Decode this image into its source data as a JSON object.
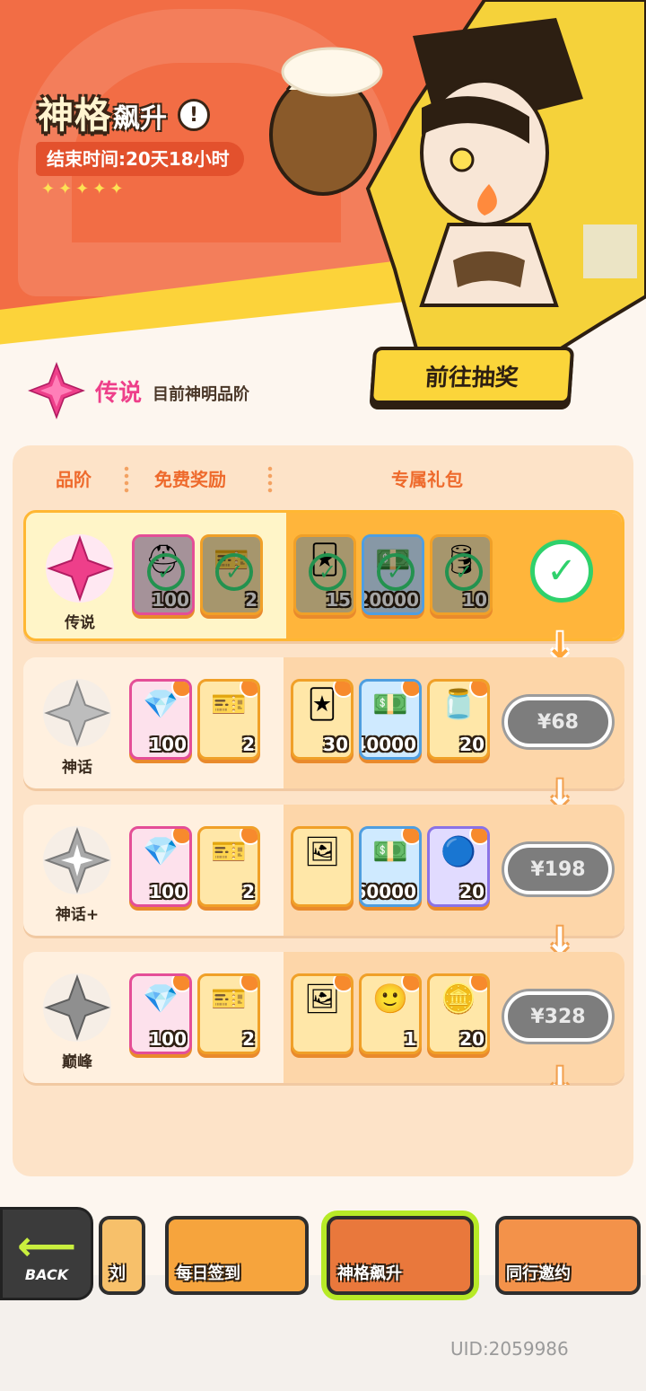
{
  "header": {
    "title_main": "神格",
    "title_sub": "飙升",
    "info_icon": "!",
    "end_time": "结束时间:20天18小时",
    "stars": "✦✦✦✦✦",
    "draw_button": "前往抽奖"
  },
  "current_tier": {
    "name": "传说",
    "description": "目前神明品阶"
  },
  "columns": {
    "tier": "品阶",
    "free": "免费奖励",
    "exclusive": "专属礼包"
  },
  "rows": [
    {
      "tier": "传说",
      "state": "claimed",
      "items": [
        {
          "icon": "helmet-icon",
          "count": "100",
          "color": "pink"
        },
        {
          "icon": "ticket-icon",
          "count": "2",
          "color": "gold"
        },
        {
          "icon": "card-pack-icon",
          "count": "15",
          "color": "gold"
        },
        {
          "icon": "cash-icon",
          "count": "20000",
          "color": "blue"
        },
        {
          "icon": "barrel-icon",
          "count": "10",
          "color": "gold"
        }
      ]
    },
    {
      "tier": "神话",
      "price": "¥68",
      "items": [
        {
          "icon": "diamond-icon",
          "count": "100",
          "color": "pink"
        },
        {
          "icon": "ticket-icon",
          "count": "2",
          "color": "gold"
        },
        {
          "icon": "card-pack-icon",
          "count": "30",
          "color": "gold"
        },
        {
          "icon": "cash-icon",
          "count": "40000",
          "color": "blue"
        },
        {
          "icon": "potion-jar-icon",
          "count": "20",
          "color": "gold"
        }
      ]
    },
    {
      "tier": "神话+",
      "price": "¥198",
      "items": [
        {
          "icon": "diamond-icon",
          "count": "100",
          "color": "pink"
        },
        {
          "icon": "ticket-icon",
          "count": "2",
          "color": "gold"
        },
        {
          "icon": "character-card-icon",
          "count": "",
          "color": "gold"
        },
        {
          "icon": "cash-icon",
          "count": "60000",
          "color": "blue"
        },
        {
          "icon": "token-card-icon",
          "count": "20",
          "color": "purple"
        }
      ]
    },
    {
      "tier": "巅峰",
      "price": "¥328",
      "items": [
        {
          "icon": "diamond-icon",
          "count": "100",
          "color": "pink"
        },
        {
          "icon": "ticket-icon",
          "count": "2",
          "color": "gold"
        },
        {
          "icon": "character-card-icon",
          "count": "",
          "color": "gold"
        },
        {
          "icon": "avatar-frame-icon",
          "count": "1",
          "color": "gold"
        },
        {
          "icon": "coin-card-icon",
          "count": "20",
          "color": "gold"
        }
      ]
    }
  ],
  "bottom_nav": {
    "back_label": "BACK",
    "cards": [
      {
        "label": "刘"
      },
      {
        "label": "每日签到"
      },
      {
        "label": "神格飙升"
      },
      {
        "label": "同行邀约"
      }
    ]
  },
  "uid": "UID:2059986",
  "colors": {
    "banner": "#f26d45",
    "accent_yellow": "#fbd53a",
    "legend_pink": "#ee3f8a",
    "check_green": "#2fd16c"
  }
}
